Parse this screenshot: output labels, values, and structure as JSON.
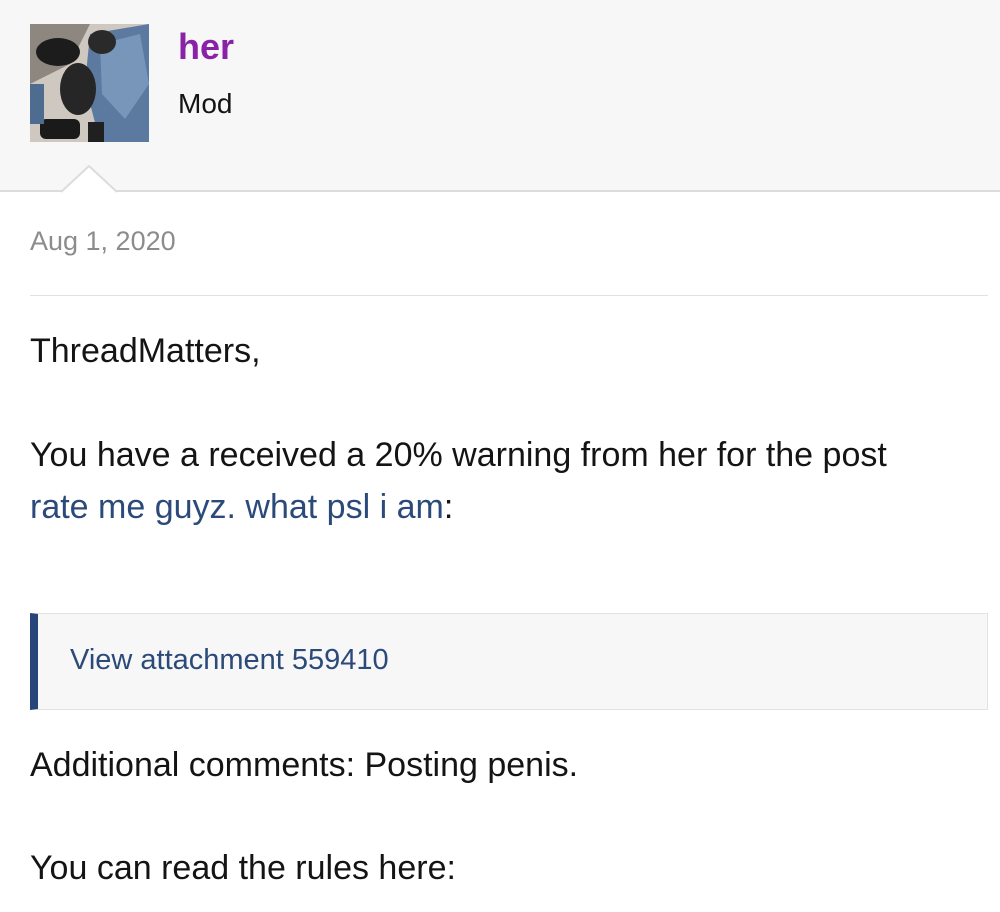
{
  "user": {
    "name": "her",
    "title": "Mod",
    "name_color": "#8a22a8"
  },
  "post": {
    "date": "Aug 1, 2020",
    "greeting": "ThreadMatters,",
    "warning_text": "You have a received a 20% warning from her for the post",
    "post_link": "rate me guyz. what psl i am",
    "post_link_suffix": ":",
    "attachment_link": "View attachment 559410",
    "additional_comments": "Additional comments: Posting penis.",
    "rules_text": "You can read the rules here:"
  },
  "colors": {
    "link": "#2b4a7a",
    "quote_bar": "#26457a",
    "header_bg": "#f7f7f7"
  }
}
